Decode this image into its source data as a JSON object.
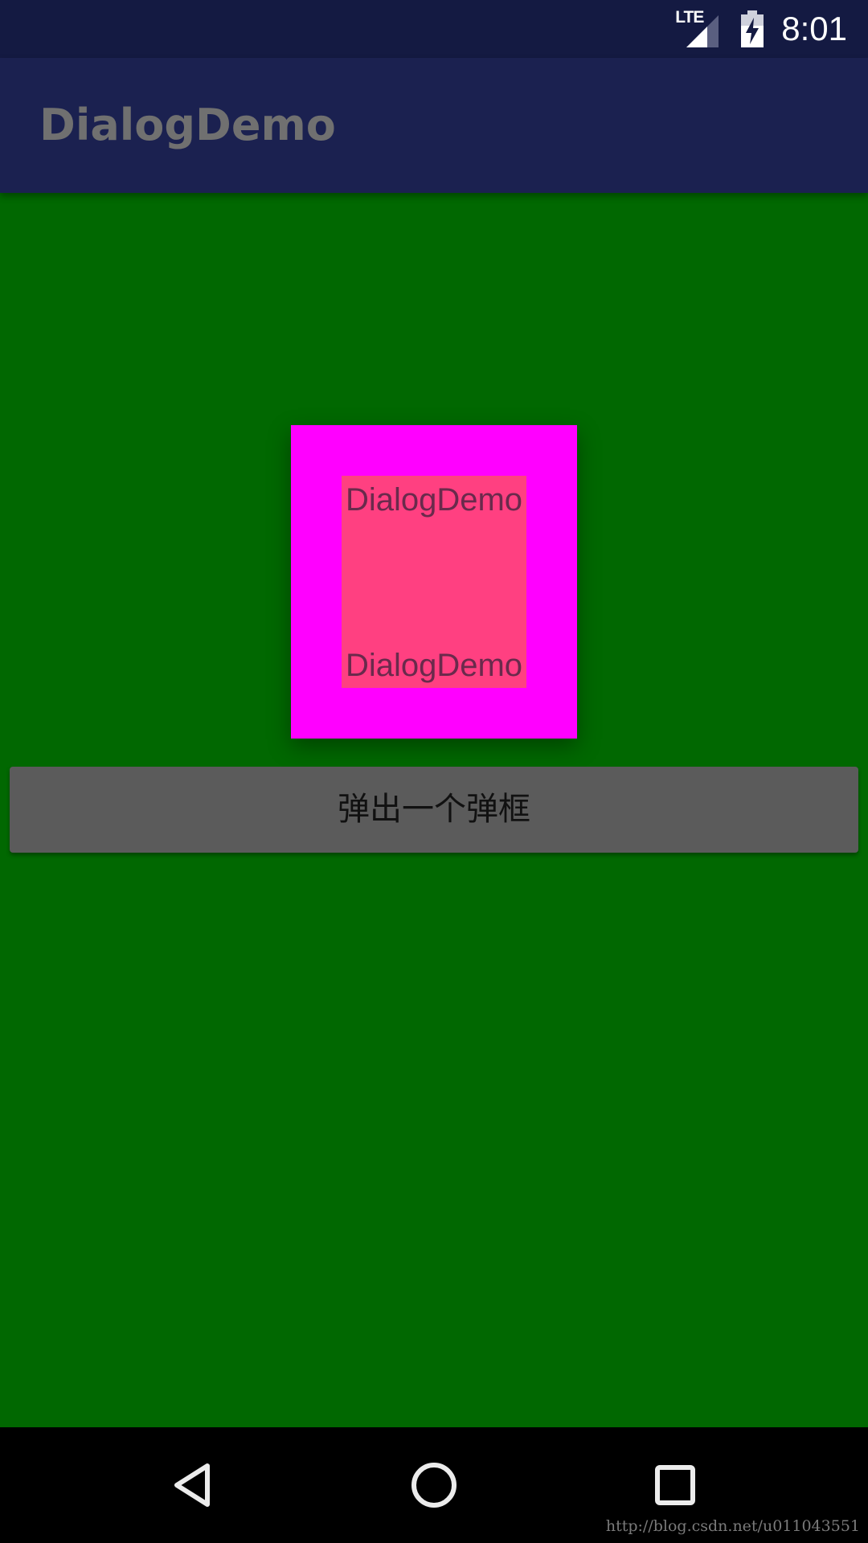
{
  "status_bar": {
    "network_label": "LTE",
    "time": "8:01",
    "icons": [
      "signal-icon",
      "battery-charging-icon"
    ]
  },
  "app_bar": {
    "title": "DialogDemo"
  },
  "dialog": {
    "text_top": "DialogDemo",
    "text_bottom": "DialogDemo"
  },
  "main": {
    "button_label": "弹出一个弹框"
  },
  "nav_bar": {
    "icons": [
      "back-icon",
      "home-icon",
      "recents-icon"
    ]
  },
  "watermark": "http://blog.csdn.net/u011043551",
  "colors": {
    "status_bar": "#141a42",
    "app_bar": "#1b2150",
    "background": "#016801",
    "dialog_outer": "#ff00ff",
    "dialog_inner": "#ff4081",
    "button": "#5b5b5b",
    "nav_bar": "#000000"
  }
}
